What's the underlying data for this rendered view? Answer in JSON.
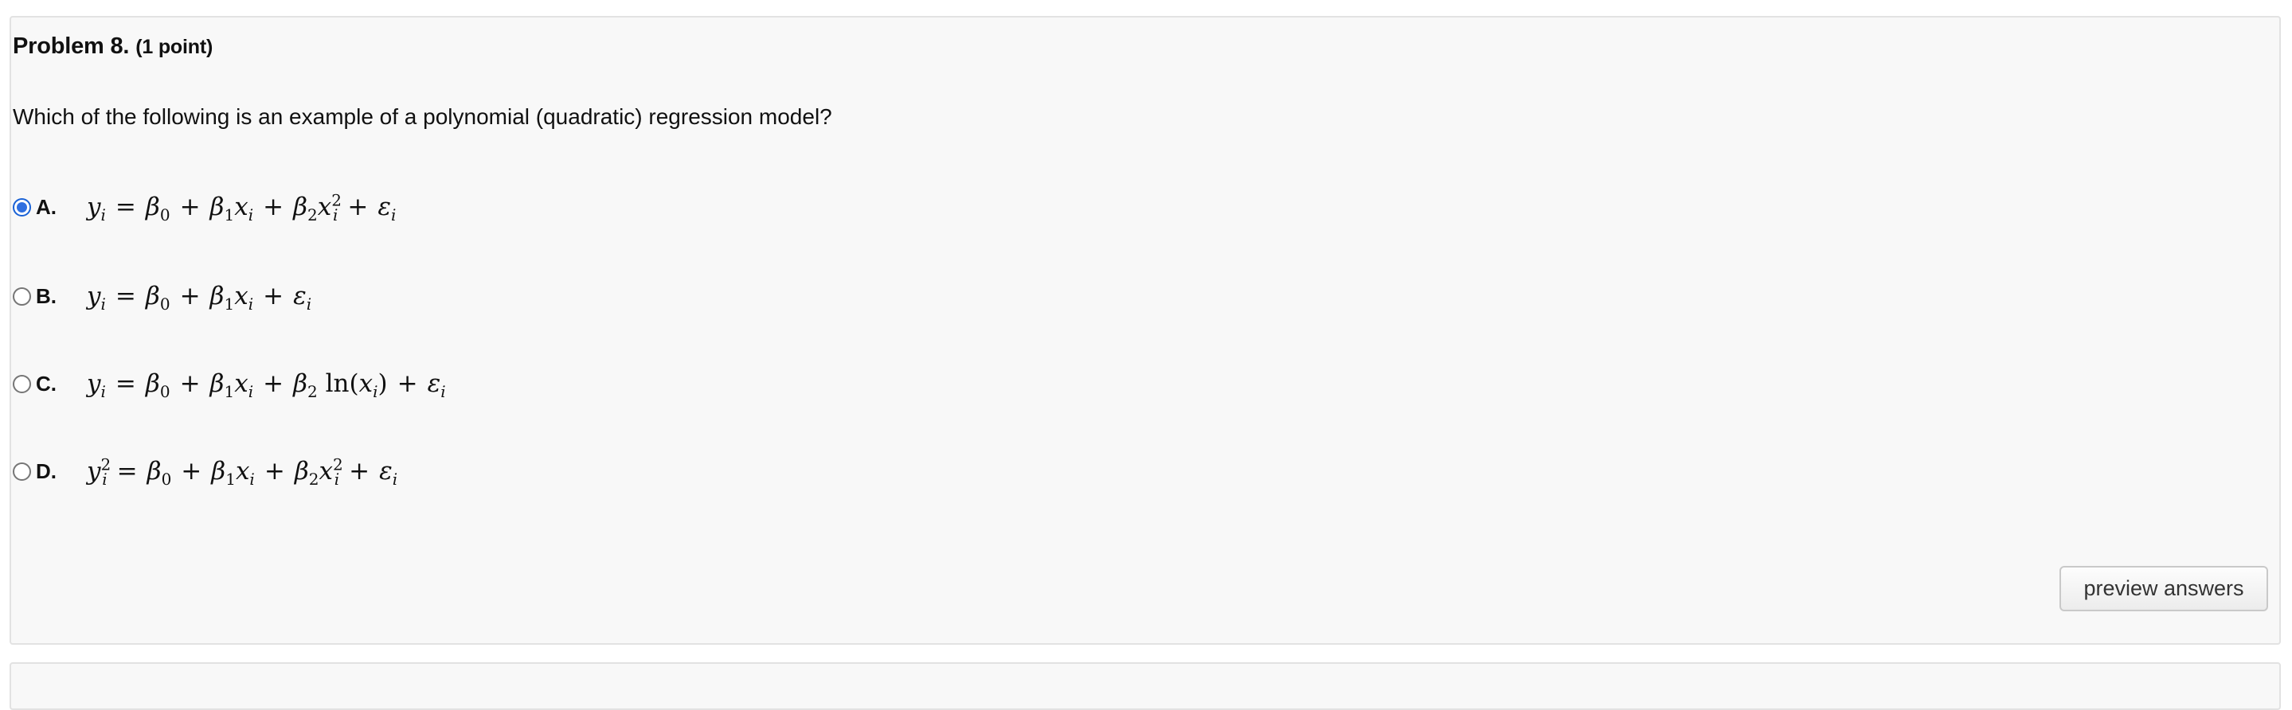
{
  "problem": {
    "title": "Problem 8.",
    "points": "(1 point)",
    "question": "Which of the following is an example of a polynomial (quadratic) regression model?"
  },
  "options": [
    {
      "letter": "A.",
      "selected": true,
      "formula_text": "yi = β0 + β1xi + β2xi^2 + εi"
    },
    {
      "letter": "B.",
      "selected": false,
      "formula_text": "yi = β0 + β1xi + εi"
    },
    {
      "letter": "C.",
      "selected": false,
      "formula_text": "yi = β0 + β1xi + β2 ln(xi) + εi"
    },
    {
      "letter": "D.",
      "selected": false,
      "formula_text": "yi^2 = β0 + β1xi + β2xi^2 + εi"
    }
  ],
  "actions": {
    "preview_label": "preview answers"
  },
  "colors": {
    "radio_selected": "#2f6fe0",
    "card_background": "#f8f8f8",
    "card_border": "#e2e2e2"
  }
}
